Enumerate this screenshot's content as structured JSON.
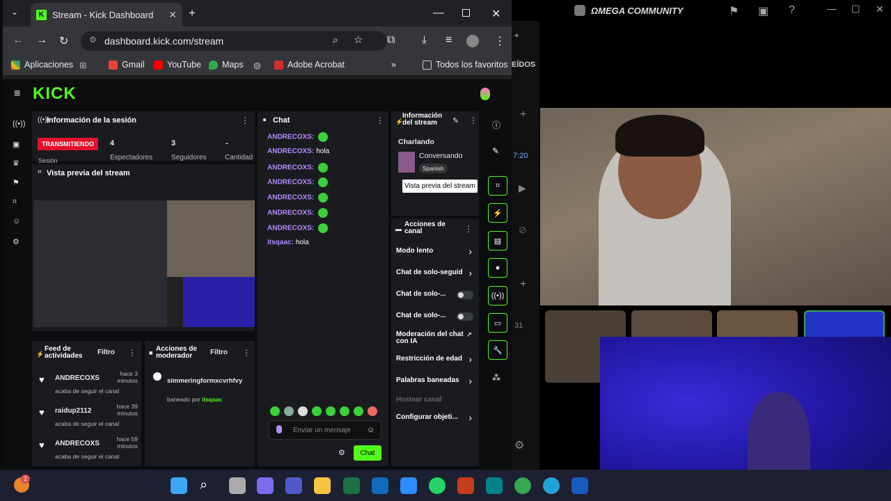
{
  "browser": {
    "tab_title": "Stream - Kick Dashboard",
    "url": "dashboard.kick.com/stream",
    "bookmarks": [
      "Aplicaciones",
      "Gmail",
      "YouTube",
      "Maps",
      "Adobe Acrobat",
      "Todos los favoritos"
    ]
  },
  "kick": {
    "logo": "KICK",
    "session": {
      "title": "Información de la sesión",
      "badge": "TRANSMITIENDO",
      "badge_color": "#e0112b",
      "stats": [
        {
          "value": "4",
          "label": "Espectadores"
        },
        {
          "value": "3",
          "label": "Seguidores"
        },
        {
          "value": "-",
          "label": "Cantidad"
        }
      ],
      "session_label": "Sesión"
    },
    "preview_title": "Vista previa del stream",
    "chat": {
      "title": "Chat",
      "messages": [
        {
          "user": "ANDRECOXS:",
          "text": ""
        },
        {
          "user": "ANDRECOXS:",
          "text": "hola"
        },
        {
          "user": "ANDRECOXS:",
          "text": ""
        },
        {
          "user": "ANDRECOXS:",
          "text": ""
        },
        {
          "user": "ANDRECOXS:",
          "text": ""
        },
        {
          "user": "ANDRECOXS:",
          "text": ""
        },
        {
          "user": "ANDRECOXS:",
          "text": ""
        },
        {
          "user": "itsqaac:",
          "text": "hola"
        }
      ],
      "placeholder": "Enviar un mensaje",
      "send_label": "Chat"
    },
    "stream_info": {
      "title": "Información del stream",
      "stream_title": "Charlando",
      "category": "Conversando",
      "language": "Spanish",
      "tooltip": "Vista previa del stream"
    },
    "channel_actions": {
      "title": "Acciones de canal",
      "items": [
        "Modo lento",
        "Chat de solo-seguid",
        "Chat de solo-...",
        "Chat de solo-...",
        "Moderación del chat con IA",
        "Restricción de edad",
        "Palabras baneadas",
        "Hostear canal",
        "Configurar objeti..."
      ]
    },
    "activity_feed": {
      "title": "Feed de actividades",
      "filter": "Filtro",
      "items": [
        {
          "user": "ANDRECOXS",
          "time": "hace 3 minutos",
          "desc": "acaba de seguir el canal"
        },
        {
          "user": "raidup2112",
          "time": "hace 39 minutos",
          "desc": "acaba de seguir el canal"
        },
        {
          "user": "ANDRECOXS",
          "time": "hace 59 minutos",
          "desc": "acaba de seguir el canal"
        }
      ]
    },
    "mod_actions": {
      "title": "Acciones de moderador",
      "filter": "Filtro",
      "user": "simmeringformxcvrhfvy",
      "desc_prefix": "baneado por",
      "desc_user": "itsqaac"
    }
  },
  "discord": {
    "title": "ΩMEGA COMMUNITY",
    "leidos": "EÍDOS",
    "time_frag": "7:20",
    "count": "31"
  },
  "taskbar": {
    "badge": "2"
  }
}
